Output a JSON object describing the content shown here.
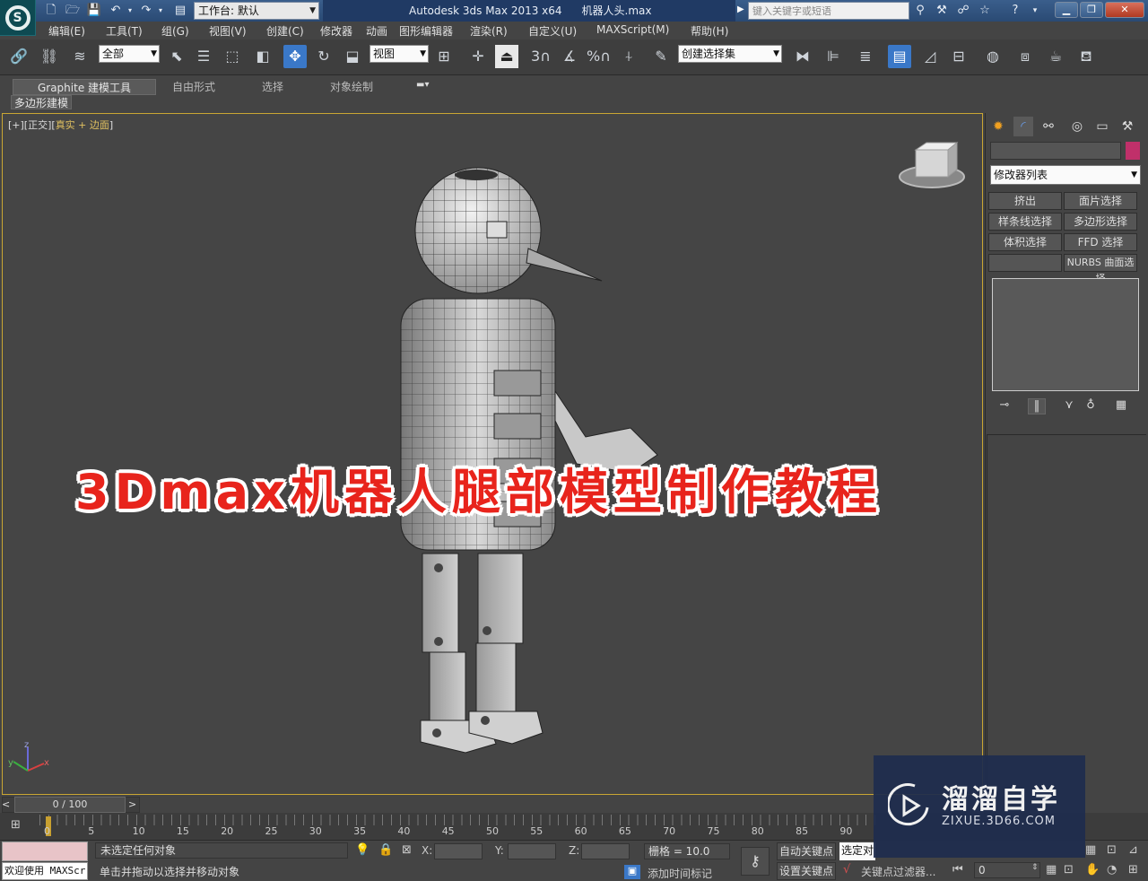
{
  "titlebar": {
    "workspace": "工作台: 默认",
    "app": "Autodesk 3ds Max  2013 x64",
    "file": "机器人头.max",
    "search_placeholder": "键入关键字或短语"
  },
  "menu": [
    "编辑(E)",
    "工具(T)",
    "组(G)",
    "视图(V)",
    "创建(C)",
    "修改器",
    "动画",
    "图形编辑器",
    "渲染(R)",
    "自定义(U)",
    "MAXScript(M)",
    "帮助(H)"
  ],
  "toolbar": {
    "filter": "全部",
    "coord": "视图",
    "snap_label": "3",
    "angle_snap_label": "%",
    "named_selection": "创建选择集"
  },
  "ribbon": {
    "tabs": [
      "Graphite 建模工具",
      "自由形式",
      "选择",
      "对象绘制"
    ],
    "sub": "多边形建模"
  },
  "viewport": {
    "label_bracket_open": "[+][",
    "view": "正交",
    "label_mid": "][",
    "shading": "真实 + 边面",
    "label_end": "]",
    "axis_x": "x",
    "axis_y": "y",
    "axis_z": "z"
  },
  "command_panel": {
    "modifier_list": "修改器列表",
    "buttons": [
      "挤出",
      "面片选择",
      "样条线选择",
      "多边形选择",
      "体积选择",
      "FFD 选择",
      "",
      "NURBS 曲面选择"
    ]
  },
  "timeline": {
    "slider": "0 / 100",
    "ticks": [
      "0",
      "5",
      "10",
      "15",
      "20",
      "25",
      "30",
      "35",
      "40",
      "45",
      "50",
      "55",
      "60",
      "65",
      "70",
      "75",
      "80",
      "85",
      "90"
    ]
  },
  "status": {
    "maxscript": "欢迎使用 MAXScr",
    "selection": "未选定任何对象",
    "prompt": "单击并拖动以选择并移动对象",
    "x_label": "X:",
    "y_label": "Y:",
    "z_label": "Z:",
    "grid": "栅格 = 10.0",
    "add_time_tag": "添加时间标记",
    "auto_key": "自动关键点",
    "set_key": "设置关键点",
    "selected": "选定对",
    "key_filters": "关键点过滤器...",
    "frame": "0"
  },
  "overlay": {
    "title": "3Dmax机器人腿部模型制作教程"
  },
  "watermark": {
    "name": "溜溜自学",
    "url": "ZIXUE.3D66.COM"
  },
  "colors": {
    "viewport_bg": "#454545",
    "viewport_border": "#c9a633",
    "title_red": "#e8241c",
    "object_color": "#c0306a"
  }
}
